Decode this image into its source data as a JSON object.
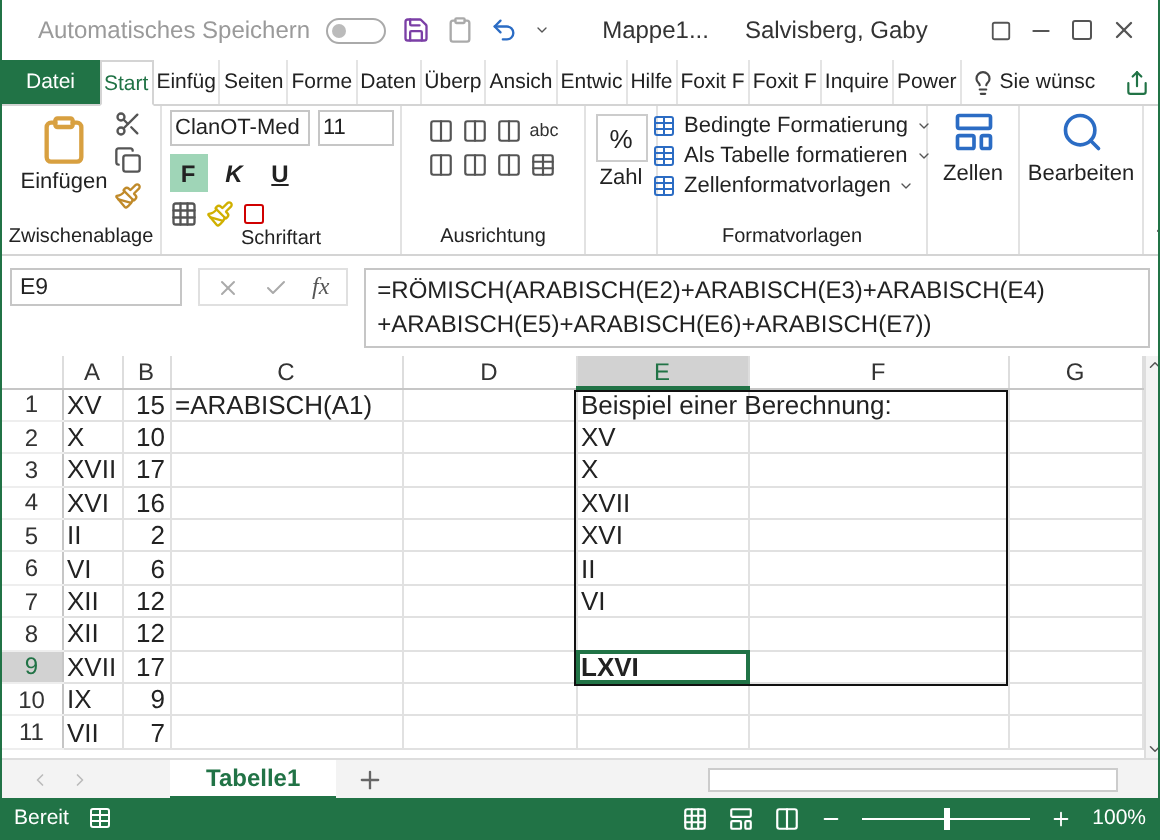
{
  "title_bar": {
    "autosave_label": "Automatisches Speichern",
    "autosave_on": false,
    "filename": "Mappe1...",
    "user": "Salvisberg, Gaby"
  },
  "ribbon_tabs": [
    {
      "label": "Datei",
      "kind": "file",
      "selected": false
    },
    {
      "label": "Start",
      "kind": "tab",
      "selected": true
    },
    {
      "label": "Einfüg",
      "kind": "tab",
      "selected": false
    },
    {
      "label": "Seiten",
      "kind": "tab",
      "selected": false
    },
    {
      "label": "Forme",
      "kind": "tab",
      "selected": false
    },
    {
      "label": "Daten",
      "kind": "tab",
      "selected": false
    },
    {
      "label": "Überp",
      "kind": "tab",
      "selected": false
    },
    {
      "label": "Ansich",
      "kind": "tab",
      "selected": false
    },
    {
      "label": "Entwic",
      "kind": "tab",
      "selected": false
    },
    {
      "label": "Hilfe",
      "kind": "tab",
      "selected": false
    },
    {
      "label": "Foxit F",
      "kind": "tab",
      "selected": false
    },
    {
      "label": "Foxit F",
      "kind": "tab",
      "selected": false
    },
    {
      "label": "Inquire",
      "kind": "tab",
      "selected": false
    },
    {
      "label": "Power",
      "kind": "tab",
      "selected": false
    }
  ],
  "tell_me": "Sie wünsc",
  "clipboard": {
    "paste": "Einfügen",
    "label": "Zwischenablage"
  },
  "font": {
    "name": "ClanOT-Med",
    "size": "11",
    "bold_label": "F",
    "italic_label": "K",
    "underline_label": "U",
    "bold": true,
    "label": "Schriftart"
  },
  "alignment": {
    "label": "Ausrichtung",
    "wrap_label": "abc"
  },
  "number": {
    "symbol": "%",
    "label": "Zahl"
  },
  "styles": {
    "items": [
      "Bedingte Formatierung",
      "Als Tabelle formatieren",
      "Zellenformatvorlagen"
    ],
    "label": "Formatvorlagen"
  },
  "cells": {
    "label": "Zellen"
  },
  "editing": {
    "label": "Bearbeiten"
  },
  "formula_bar": {
    "name_box": "E9",
    "fx": "fx",
    "formula_lines": [
      "=RÖMISCH(ARABISCH(E2)+ARABISCH(E3)+ARABISCH(E4)",
      "+ARABISCH(E5)+ARABISCH(E6)+ARABISCH(E7))"
    ]
  },
  "grid": {
    "columns": [
      {
        "label": "A",
        "selected": false
      },
      {
        "label": "B",
        "selected": false
      },
      {
        "label": "C",
        "selected": false
      },
      {
        "label": "D",
        "selected": false
      },
      {
        "label": "E",
        "selected": true
      },
      {
        "label": "F",
        "selected": false
      },
      {
        "label": "G",
        "selected": false
      }
    ],
    "rows": [
      {
        "label": "1",
        "selected": false,
        "cells": [
          {
            "text": "XV",
            "kind": "text",
            "active": false
          },
          {
            "text": "15",
            "kind": "number",
            "active": false
          },
          {
            "text": "=ARABISCH(A1)",
            "kind": "text",
            "active": false
          },
          null,
          {
            "text": "Beispiel einer Berechnung:",
            "kind": "text",
            "active": false
          }
        ]
      },
      {
        "label": "2",
        "selected": false,
        "cells": [
          {
            "text": "X",
            "kind": "text",
            "active": false
          },
          {
            "text": "10",
            "kind": "number",
            "active": false
          },
          null,
          null,
          {
            "text": "XV",
            "kind": "text",
            "active": false
          }
        ]
      },
      {
        "label": "3",
        "selected": false,
        "cells": [
          {
            "text": "XVII",
            "kind": "text",
            "active": false
          },
          {
            "text": "17",
            "kind": "number",
            "active": false
          },
          null,
          null,
          {
            "text": "X",
            "kind": "text",
            "active": false
          }
        ]
      },
      {
        "label": "4",
        "selected": false,
        "cells": [
          {
            "text": "XVI",
            "kind": "text",
            "active": false
          },
          {
            "text": "16",
            "kind": "number",
            "active": false
          },
          null,
          null,
          {
            "text": "XVII",
            "kind": "text",
            "active": false
          }
        ]
      },
      {
        "label": "5",
        "selected": false,
        "cells": [
          {
            "text": "II",
            "kind": "text",
            "active": false
          },
          {
            "text": "2",
            "kind": "number",
            "active": false
          },
          null,
          null,
          {
            "text": "XVI",
            "kind": "text",
            "active": false
          }
        ]
      },
      {
        "label": "6",
        "selected": false,
        "cells": [
          {
            "text": "VI",
            "kind": "text",
            "active": false
          },
          {
            "text": "6",
            "kind": "number",
            "active": false
          },
          null,
          null,
          {
            "text": "II",
            "kind": "text",
            "active": false
          }
        ]
      },
      {
        "label": "7",
        "selected": false,
        "cells": [
          {
            "text": "XII",
            "kind": "text",
            "active": false
          },
          {
            "text": "12",
            "kind": "number",
            "active": false
          },
          null,
          null,
          {
            "text": "VI",
            "kind": "text",
            "active": false
          }
        ]
      },
      {
        "label": "8",
        "selected": false,
        "cells": [
          {
            "text": "XII",
            "kind": "text",
            "active": false
          },
          {
            "text": "12",
            "kind": "number",
            "active": false
          }
        ]
      },
      {
        "label": "9",
        "selected": true,
        "cells": [
          {
            "text": "XVII",
            "kind": "text",
            "active": false
          },
          {
            "text": "17",
            "kind": "number",
            "active": false
          },
          null,
          null,
          {
            "text": "LXVI",
            "kind": "text",
            "bold": true,
            "active": true
          }
        ]
      },
      {
        "label": "10",
        "selected": false,
        "cells": [
          {
            "text": "IX",
            "kind": "text",
            "active": false
          },
          {
            "text": "9",
            "kind": "number",
            "active": false
          }
        ]
      },
      {
        "label": "11",
        "selected": false,
        "cells": [
          {
            "text": "VII",
            "kind": "text",
            "active": false
          },
          {
            "text": "7",
            "kind": "number",
            "active": false
          }
        ]
      }
    ]
  },
  "sheet_tabs": [
    {
      "label": "Tabelle1",
      "selected": true
    }
  ],
  "status_bar": {
    "status": "Bereit",
    "zoom": "100%",
    "zoom_level": {
      "level": 0.5
    }
  }
}
